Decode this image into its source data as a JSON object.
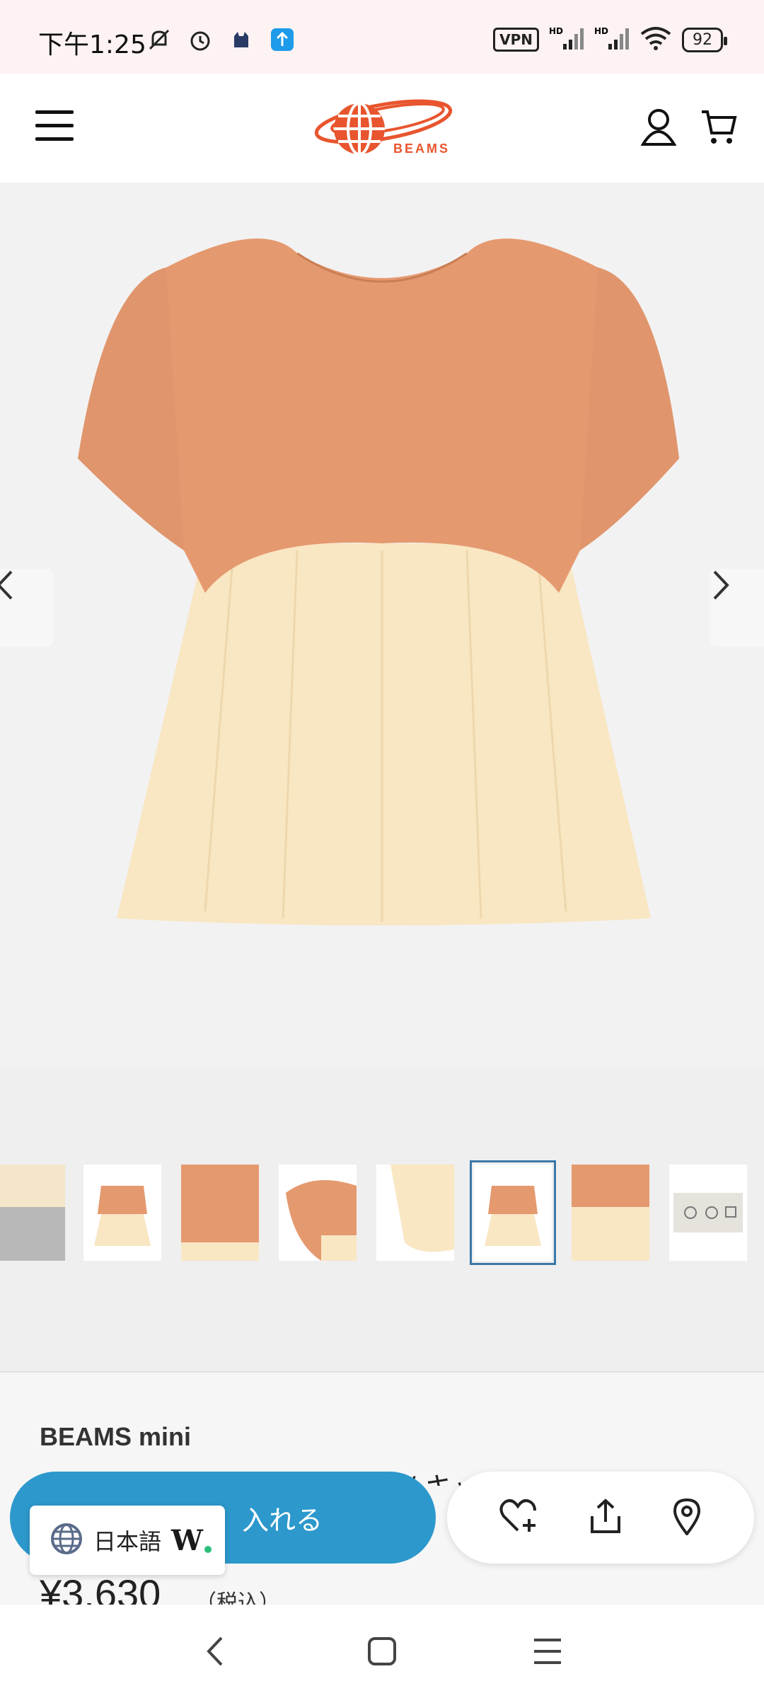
{
  "status_bar": {
    "time": "下午1:25",
    "vpn": "VPN",
    "battery": "92",
    "hd1": "HD",
    "hd2": "HD"
  },
  "header": {
    "logo_text": "BEAMS",
    "brand_color": "#e8552e"
  },
  "gallery": {
    "thumbnail_count": 8,
    "selected_index": 5
  },
  "product": {
    "brand": "BEAMS mini",
    "title_partial": "ワッフル 切り替え ブラウス / キッズ 90-130",
    "price": "¥3,630",
    "tax_label": "（税込）"
  },
  "cta": {
    "label": "入れる",
    "color": "#2d98cc"
  },
  "language": {
    "label": "日本語",
    "logo": "W."
  },
  "icons": {
    "favorite": "heart-plus-icon",
    "share": "share-icon",
    "location": "location-pin-icon"
  }
}
